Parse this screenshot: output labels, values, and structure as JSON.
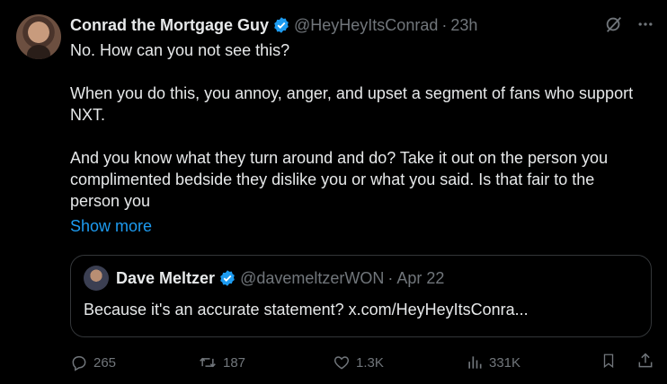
{
  "tweet": {
    "author_name": "Conrad the Mortgage Guy",
    "handle": "@HeyHeyItsConrad",
    "dot": "·",
    "time": "23h",
    "paragraphs": [
      "No. How can you not see this?",
      "When you do this, you annoy, anger, and upset a segment of fans who support NXT.",
      "And you know what they turn around and do? Take it out on the person you complimented bedside they dislike you or what you said. Is that fair to the person you"
    ],
    "show_more": "Show more"
  },
  "quote": {
    "author_name": "Dave Meltzer",
    "handle": "@davemeltzerWON",
    "dot": "·",
    "date": "Apr 22",
    "text": "Because it's an accurate statement? x.com/HeyHeyItsConra..."
  },
  "actions": {
    "replies": "265",
    "reposts": "187",
    "likes": "1.3K",
    "views": "331K"
  },
  "colors": {
    "background": "#000000",
    "text": "#e7e9ea",
    "muted": "#71767b",
    "accent": "#1d9bf0",
    "border": "#333639"
  },
  "icons": [
    "verified-badge-icon",
    "grok-icon",
    "more-icon",
    "reply-icon",
    "repost-icon",
    "like-icon",
    "views-icon",
    "bookmark-icon",
    "share-icon"
  ]
}
